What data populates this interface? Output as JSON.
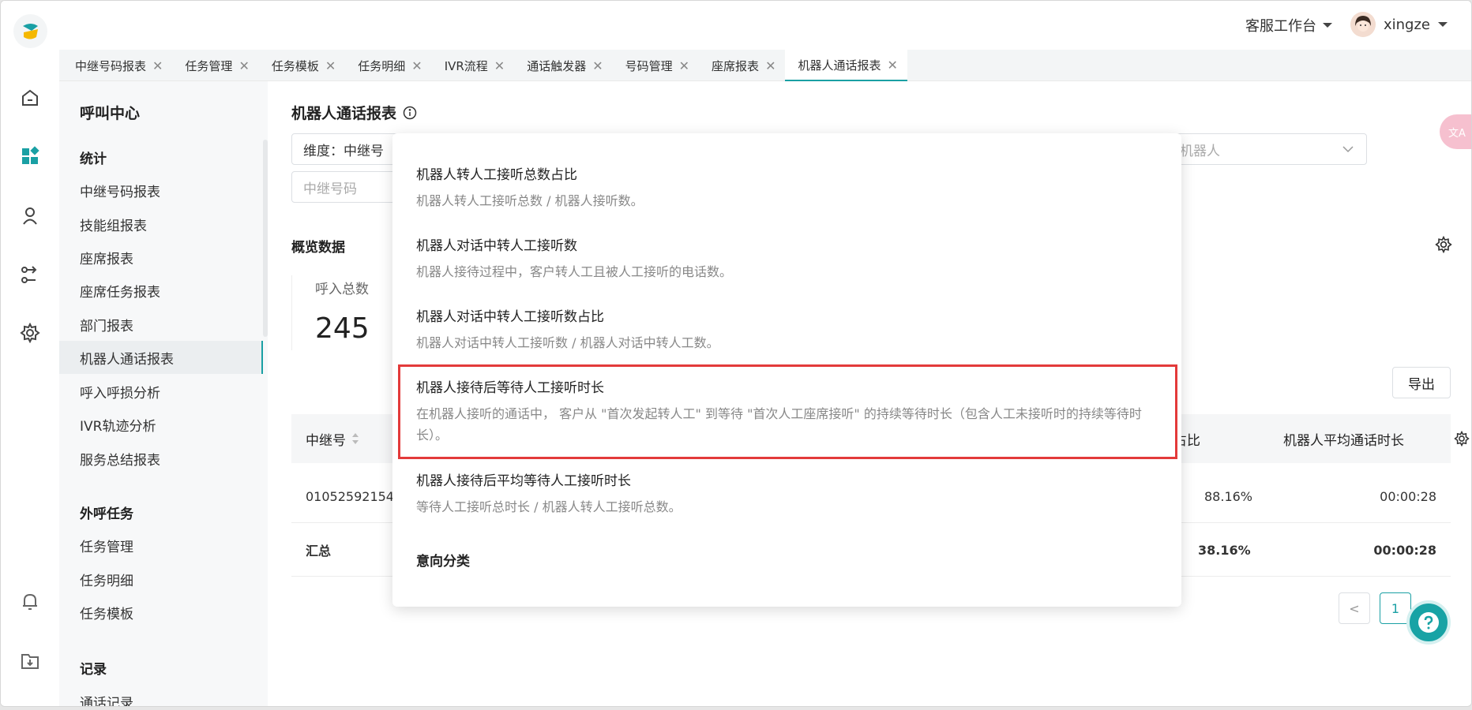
{
  "header": {
    "workspace_label": "客服工作台",
    "username": "xingze"
  },
  "tabs": [
    {
      "label": "中继号码报表"
    },
    {
      "label": "任务管理"
    },
    {
      "label": "任务模板"
    },
    {
      "label": "任务明细"
    },
    {
      "label": "IVR流程"
    },
    {
      "label": "通话触发器"
    },
    {
      "label": "号码管理"
    },
    {
      "label": "座席报表"
    },
    {
      "label": "机器人通话报表"
    }
  ],
  "sidebar": {
    "title": "呼叫中心",
    "section_stats": "统计",
    "stats_items": [
      "中继号码报表",
      "技能组报表",
      "座席报表",
      "座席任务报表",
      "部门报表",
      "机器人通话报表",
      "呼入呼损分析",
      "IVR轨迹分析",
      "服务总结报表"
    ],
    "section_outbound": "外呼任务",
    "outbound_items": [
      "任务管理",
      "任务明细",
      "任务模板"
    ],
    "section_records": "记录",
    "records_items": [
      "通话记录"
    ]
  },
  "page": {
    "title": "机器人通话报表",
    "dimension_label": "维度：中继号",
    "trunk_placeholder": "中继号码",
    "robot_placeholder": "机器人",
    "overview_title": "概览数据",
    "stat_label": "呼入总数",
    "stat_value": "245",
    "export_label": "导出"
  },
  "table": {
    "col_trunk": "中继号",
    "col_ratio": "待占比",
    "col_avg": "机器人平均通话时长",
    "rows": [
      {
        "trunk": "01052592154",
        "ratio": "88.16%",
        "avg": "00:00:28"
      }
    ],
    "summary": {
      "label": "汇总",
      "ratio": "38.16%",
      "avg": "00:00:28"
    }
  },
  "pager": {
    "prev": "<",
    "page": "1"
  },
  "popover": {
    "items": [
      {
        "title": "机器人转人工接听总数占比",
        "desc": "机器人转人工接听总数 / 机器人接听数。"
      },
      {
        "title": "机器人对话中转人工接听数",
        "desc": "机器人接待过程中，客户转人工且被人工接听的电话数。"
      },
      {
        "title": "机器人对话中转人工接听数占比",
        "desc": "机器人对话中转人工接听数 / 机器人对话中转人工数。"
      },
      {
        "title": "机器人接待后等待人工接听时长",
        "desc": "在机器人接听的通话中， 客户从 \"首次发起转人工\" 到等待 \"首次人工座席接听\" 的持续等待时长（包含人工未接听时的持续等待时长）。"
      },
      {
        "title": "机器人接待后平均等待人工接听时长",
        "desc": "等待人工接听总时长 / 机器人转人工接听总数。"
      }
    ],
    "section": "意向分类"
  },
  "colors": {
    "accent": "#1aa0a4",
    "highlight": "#e33a3a"
  }
}
